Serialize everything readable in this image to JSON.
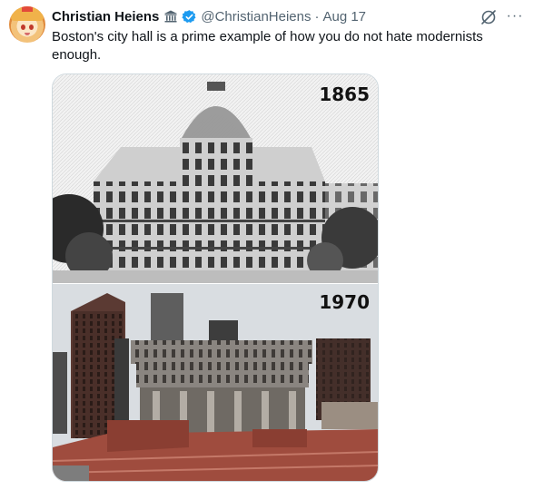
{
  "tweet": {
    "author_name": "Christian Heiens",
    "author_handle": "@ChristianHeiens",
    "separator": "·",
    "date": "Aug 17",
    "text": "Boston's city hall is a prime example of how you do not hate modernists enough.",
    "affiliate_badge_icon": "government-building-icon",
    "verified_icon": "verified-badge-icon",
    "grok_icon": "grok-icon",
    "more_icon": "more-options-icon",
    "more_symbol": "···",
    "colors": {
      "verified_blue": "#1d9bf0",
      "secondary_text": "#536471",
      "primary_text": "#0f1419"
    }
  },
  "media": {
    "top_image": {
      "label": "1865",
      "description_icon": "old-city-hall-photo"
    },
    "bottom_image": {
      "label": "1970",
      "description_icon": "brutalist-city-hall-photo"
    }
  }
}
